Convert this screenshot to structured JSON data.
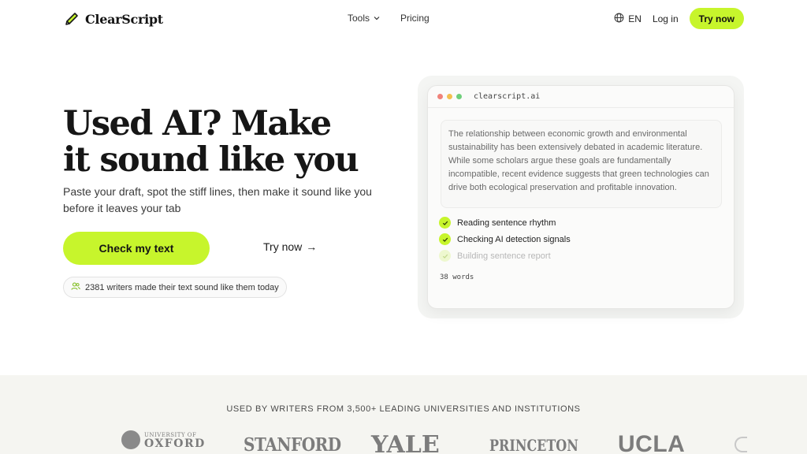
{
  "nav": {
    "brand": "ClearScript",
    "links": [
      {
        "label": "Tools",
        "has_dropdown": true
      },
      {
        "label": "Pricing",
        "has_dropdown": false
      }
    ],
    "language": "EN",
    "login_label": "Log in",
    "try_label": "Try now"
  },
  "hero": {
    "title_line1": "Used AI? Make",
    "title_line2": "it sound like you",
    "subtitle": "Paste your draft, spot the stiff lines, then make it sound like you before it leaves your tab",
    "primary_cta": "Check my text",
    "secondary_cta": "Try now",
    "secondary_arrow": "→",
    "social_proof": "2381 writers made their text sound like them today"
  },
  "demo": {
    "url": "clearscript.ai",
    "sample_text": "The relationship between economic growth and environmental sustainability has been extensively debated in academic literature. While some scholars argue these goals are fundamentally incompatible, recent evidence suggests that green technologies can drive both ecological preservation and profitable innovation.",
    "steps": [
      {
        "label": "Reading sentence rhythm",
        "status": "done"
      },
      {
        "label": "Checking AI detection signals",
        "status": "done"
      },
      {
        "label": "Building sentence report",
        "status": "pending"
      }
    ],
    "word_count": "38 words"
  },
  "trust": {
    "heading": "USED BY WRITERS FROM 3,500+ LEADING UNIVERSITIES AND INSTITUTIONS",
    "logos": {
      "oxford_small": "UNIVERSITY OF",
      "oxford_big": "OXFORD",
      "stanford": "STANFORD",
      "yale": "YALE",
      "princeton": "PRINCETON",
      "ucla": "UCLA"
    }
  },
  "colors": {
    "accent": "#c7f52c",
    "text": "#161616",
    "strip_bg": "#f5f5f1"
  }
}
